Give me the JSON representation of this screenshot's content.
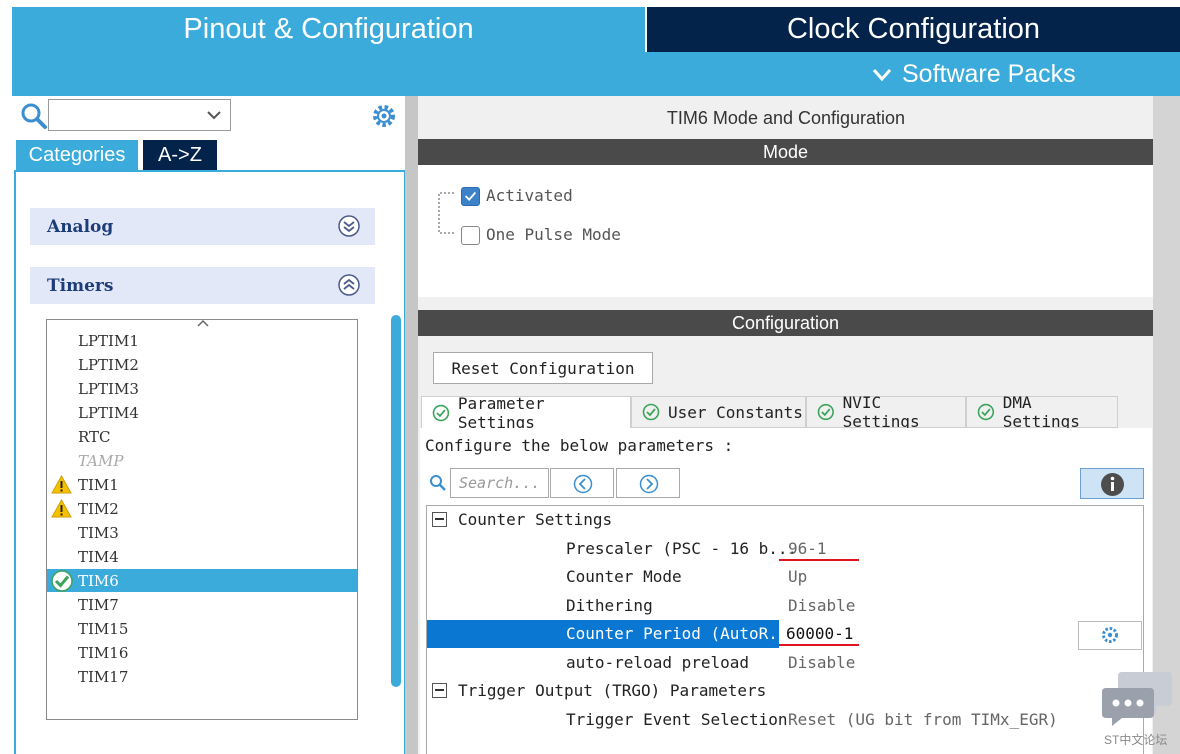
{
  "top_tabs": {
    "pinout": "Pinout & Configuration",
    "clock": "Clock Configuration"
  },
  "software_packs": "Software Packs",
  "left": {
    "category_tabs": [
      "Categories",
      "A->Z"
    ],
    "groups": {
      "analog": "Analog",
      "timers": "Timers"
    },
    "timers": [
      {
        "label": "LPTIM1"
      },
      {
        "label": "LPTIM2"
      },
      {
        "label": "LPTIM3"
      },
      {
        "label": "LPTIM4"
      },
      {
        "label": "RTC"
      },
      {
        "label": "TAMP",
        "state": "disabled"
      },
      {
        "label": "TIM1",
        "state": "warning"
      },
      {
        "label": "TIM2",
        "state": "warning"
      },
      {
        "label": "TIM3"
      },
      {
        "label": "TIM4"
      },
      {
        "label": "TIM6",
        "state": "selected"
      },
      {
        "label": "TIM7"
      },
      {
        "label": "TIM15"
      },
      {
        "label": "TIM16"
      },
      {
        "label": "TIM17"
      }
    ]
  },
  "mode": {
    "title": "TIM6 Mode and Configuration",
    "header": "Mode",
    "activated": "Activated",
    "one_pulse": "One Pulse Mode"
  },
  "config": {
    "header": "Configuration",
    "reset": "Reset Configuration",
    "tabs": [
      "Parameter Settings",
      "User Constants",
      "NVIC Settings",
      "DMA Settings"
    ],
    "configure_text": "Configure the below parameters :",
    "search_placeholder": "Search...",
    "sections": {
      "counter": "Counter Settings",
      "trigger": "Trigger Output (TRGO) Parameters"
    },
    "params": {
      "prescaler": {
        "name": "Prescaler (PSC - 16 b...",
        "value": "96-1"
      },
      "counter_mode": {
        "name": "Counter Mode",
        "value": "Up"
      },
      "dithering": {
        "name": "Dithering",
        "value": "Disable"
      },
      "counter_period": {
        "name": "Counter Period (AutoR...",
        "value": "60000-1"
      },
      "auto_reload": {
        "name": "auto-reload preload",
        "value": "Disable"
      },
      "trigger_event": {
        "name": "Trigger Event Selection",
        "value": "Reset (UG bit from TIMx_EGR)"
      }
    }
  },
  "watermark": "ST中文论坛",
  "colors": {
    "accent": "#3babdb",
    "navy": "#03234b",
    "selection": "#0a78d2",
    "underline": "#e0141e"
  }
}
